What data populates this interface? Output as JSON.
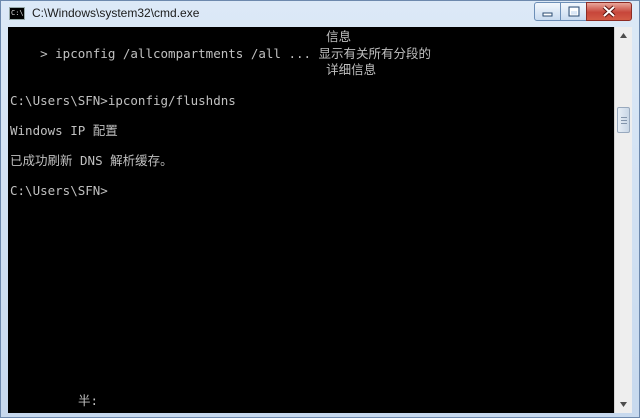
{
  "window": {
    "title": "C:\\Windows\\system32\\cmd.exe",
    "app_icon": "cmd-icon",
    "app_icon_text": "C:\\",
    "controls": [
      "minimize-icon",
      "maximize-icon",
      "close-icon"
    ]
  },
  "console": {
    "lines": [
      "                                          信息",
      "    > ipconfig /allcompartments /all ... 显示有关所有分段的",
      "                                          详细信息",
      "",
      "C:\\Users\\SFN>ipconfig/flushdns",
      "",
      "Windows IP 配置",
      "",
      "已成功刷新 DNS 解析缓存。",
      "",
      "C:\\Users\\SFN>"
    ],
    "ime_status": "半:"
  },
  "colors": {
    "console_bg": "#000000",
    "console_text": "#c0c0c0",
    "close_button": "#c7463a"
  }
}
